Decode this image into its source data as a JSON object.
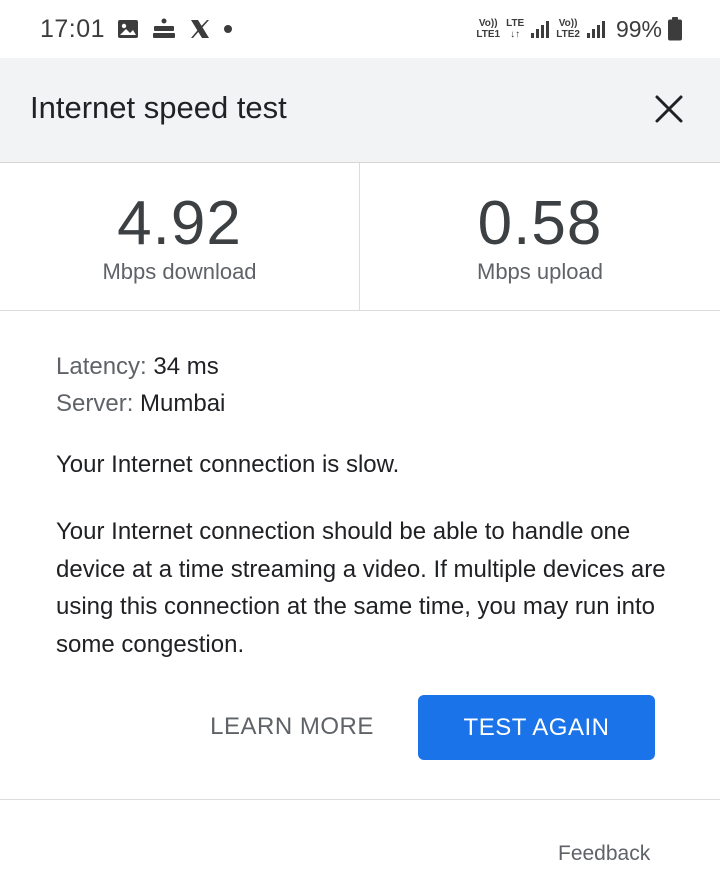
{
  "status_bar": {
    "time": "17:01",
    "icons": [
      "image-icon",
      "news-app-icon",
      "x-logo-icon",
      "dot-icon"
    ],
    "net1": {
      "top": "Vo))",
      "bottom": "LTE1"
    },
    "lte": {
      "top": "LTE",
      "bottom": "↓↑"
    },
    "net2": {
      "top": "Vo))",
      "bottom": "LTE2"
    },
    "battery": "99%"
  },
  "header": {
    "title": "Internet speed test"
  },
  "results": {
    "download": {
      "value": "4.92",
      "unit": "Mbps download"
    },
    "upload": {
      "value": "0.58",
      "unit": "Mbps upload"
    }
  },
  "details": {
    "latency_label": "Latency:",
    "latency_value": "34 ms",
    "server_label": "Server:",
    "server_value": "Mumbai"
  },
  "status_message": "Your Internet connection is slow.",
  "description": "Your Internet connection should be able to handle one device at a time streaming a video. If multiple devices are using this connection at the same time, you may run into some congestion.",
  "buttons": {
    "learn_more": "LEARN MORE",
    "test_again": "TEST AGAIN"
  },
  "feedback": "Feedback",
  "colors": {
    "accent": "#1a73e8",
    "header_bg": "#f1f3f4"
  }
}
